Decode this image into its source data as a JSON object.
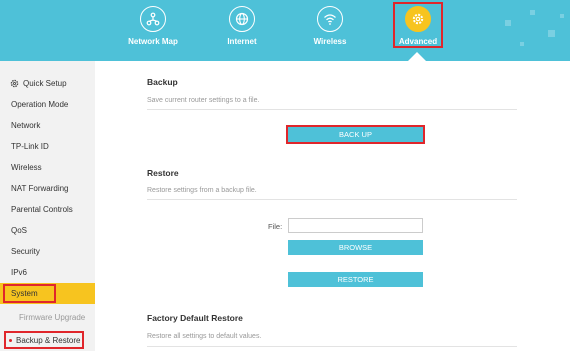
{
  "nav": {
    "items": [
      {
        "label": "Network Map",
        "icon": "network-map-icon"
      },
      {
        "label": "Internet",
        "icon": "globe-icon"
      },
      {
        "label": "Wireless",
        "icon": "wifi-icon"
      },
      {
        "label": "Advanced",
        "icon": "gear-icon"
      }
    ],
    "active": "Advanced"
  },
  "sidebar": {
    "quick_setup": "Quick Setup",
    "items": [
      "Operation Mode",
      "Network",
      "TP-Link ID",
      "Wireless",
      "NAT Forwarding",
      "Parental Controls",
      "QoS",
      "Security",
      "IPv6",
      "System"
    ],
    "sub_items": [
      "Firmware Upgrade",
      "Backup & Restore"
    ],
    "active": "System",
    "active_sub": "Backup & Restore"
  },
  "backup": {
    "title": "Backup",
    "desc": "Save current router settings to a file.",
    "button": "BACK UP"
  },
  "restore": {
    "title": "Restore",
    "desc": "Restore settings from a backup file.",
    "file_label": "File:",
    "file_value": "",
    "browse_button": "BROWSE",
    "restore_button": "RESTORE"
  },
  "factory": {
    "title": "Factory Default Restore",
    "desc": "Restore all settings to default values."
  },
  "colors": {
    "header": "#4ec1d8",
    "accent": "#f7c41f",
    "highlight": "#e0262b",
    "sidebar": "#f2f2f2"
  }
}
